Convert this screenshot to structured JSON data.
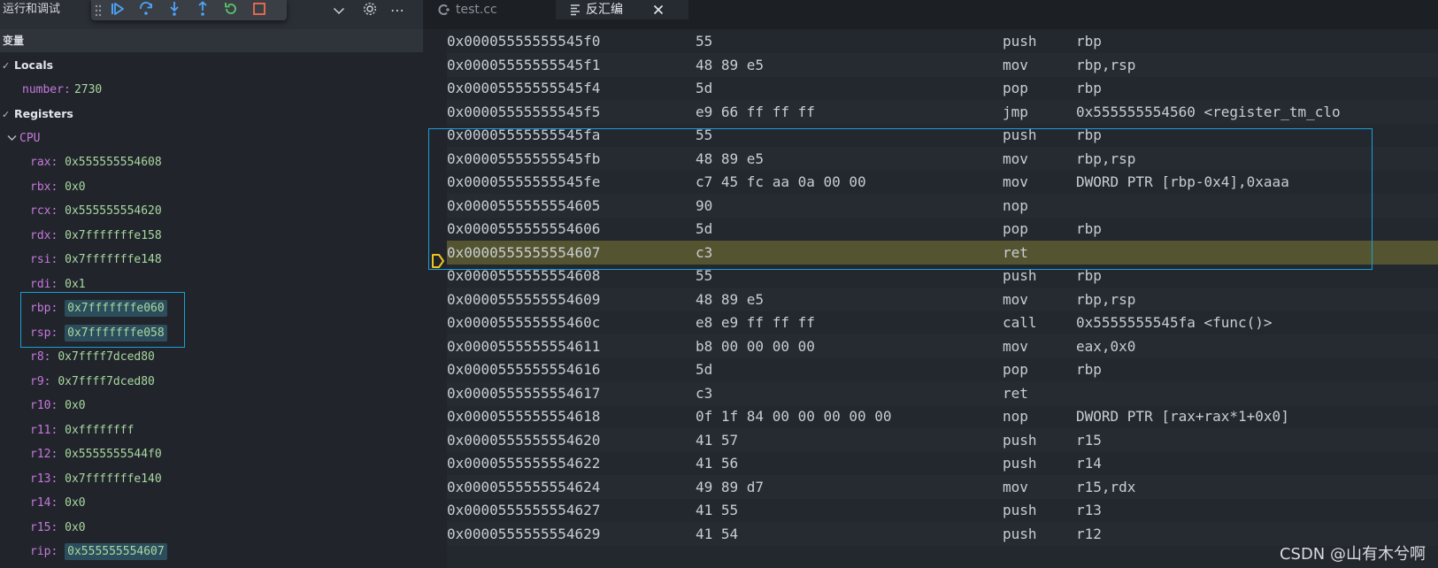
{
  "left_header": {
    "run_title": "运行和调试"
  },
  "debug_toolbar": {
    "buttons": [
      "continue",
      "step-over",
      "step-into",
      "step-out",
      "restart",
      "stop"
    ]
  },
  "variables_panel": {
    "title": "变量",
    "locals": {
      "label": "Locals",
      "vars": [
        {
          "name": "number",
          "value": "2730"
        }
      ]
    },
    "registers": {
      "label": "Registers",
      "cpu_label": "CPU",
      "items": [
        {
          "name": "rax",
          "value": "0x555555554608"
        },
        {
          "name": "rbx",
          "value": "0x0"
        },
        {
          "name": "rcx",
          "value": "0x555555554620"
        },
        {
          "name": "rdx",
          "value": "0x7fffffffe158"
        },
        {
          "name": "rsi",
          "value": "0x7fffffffe148"
        },
        {
          "name": "rdi",
          "value": "0x1"
        },
        {
          "name": "rbp",
          "value": "0x7fffffffe060"
        },
        {
          "name": "rsp",
          "value": "0x7fffffffe058"
        },
        {
          "name": "r8",
          "value": "0x7ffff7dced80"
        },
        {
          "name": "r9",
          "value": "0x7ffff7dced80"
        },
        {
          "name": "r10",
          "value": "0x0"
        },
        {
          "name": "r11",
          "value": "0xffffffff"
        },
        {
          "name": "r12",
          "value": "0x5555555544f0"
        },
        {
          "name": "r13",
          "value": "0x7fffffffe140"
        },
        {
          "name": "r14",
          "value": "0x0"
        },
        {
          "name": "r15",
          "value": "0x0"
        },
        {
          "name": "rip",
          "value": "0x555555554607"
        }
      ],
      "changed": [
        "rbp",
        "rsp",
        "rip"
      ]
    }
  },
  "tabs": [
    {
      "label": "test.cc",
      "active": false
    },
    {
      "label": "反汇编",
      "active": true
    }
  ],
  "disassembly": [
    {
      "addr": "0x00005555555545f0",
      "bytes": "55",
      "mnem": "push",
      "ops": "rbp"
    },
    {
      "addr": "0x00005555555545f1",
      "bytes": "48 89 e5",
      "mnem": "mov",
      "ops": "rbp,rsp"
    },
    {
      "addr": "0x00005555555545f4",
      "bytes": "5d",
      "mnem": "pop",
      "ops": "rbp"
    },
    {
      "addr": "0x00005555555545f5",
      "bytes": "e9 66 ff ff ff",
      "mnem": "jmp",
      "ops": "0x555555554560 <register_tm_clo"
    },
    {
      "addr": "0x00005555555545fa",
      "bytes": "55",
      "mnem": "push",
      "ops": "rbp"
    },
    {
      "addr": "0x00005555555545fb",
      "bytes": "48 89 e5",
      "mnem": "mov",
      "ops": "rbp,rsp"
    },
    {
      "addr": "0x00005555555545fe",
      "bytes": "c7 45 fc aa 0a 00 00",
      "mnem": "mov",
      "ops": "DWORD PTR [rbp-0x4],0xaaa"
    },
    {
      "addr": "0x0000555555554605",
      "bytes": "90",
      "mnem": "nop",
      "ops": ""
    },
    {
      "addr": "0x0000555555554606",
      "bytes": "5d",
      "mnem": "pop",
      "ops": "rbp"
    },
    {
      "addr": "0x0000555555554607",
      "bytes": "c3",
      "mnem": "ret",
      "ops": "",
      "current": true
    },
    {
      "addr": "0x0000555555554608",
      "bytes": "55",
      "mnem": "push",
      "ops": "rbp"
    },
    {
      "addr": "0x0000555555554609",
      "bytes": "48 89 e5",
      "mnem": "mov",
      "ops": "rbp,rsp"
    },
    {
      "addr": "0x000055555555460c",
      "bytes": "e8 e9 ff ff ff",
      "mnem": "call",
      "ops": "0x5555555545fa <func()>"
    },
    {
      "addr": "0x0000555555554611",
      "bytes": "b8 00 00 00 00",
      "mnem": "mov",
      "ops": "eax,0x0"
    },
    {
      "addr": "0x0000555555554616",
      "bytes": "5d",
      "mnem": "pop",
      "ops": "rbp"
    },
    {
      "addr": "0x0000555555554617",
      "bytes": "c3",
      "mnem": "ret",
      "ops": ""
    },
    {
      "addr": "0x0000555555554618",
      "bytes": "0f 1f 84 00 00 00 00 00",
      "mnem": "nop",
      "ops": "DWORD PTR [rax+rax*1+0x0]"
    },
    {
      "addr": "0x0000555555554620",
      "bytes": "41 57",
      "mnem": "push",
      "ops": "r15"
    },
    {
      "addr": "0x0000555555554622",
      "bytes": "41 56",
      "mnem": "push",
      "ops": "r14"
    },
    {
      "addr": "0x0000555555554624",
      "bytes": "49 89 d7",
      "mnem": "mov",
      "ops": "r15,rdx"
    },
    {
      "addr": "0x0000555555554627",
      "bytes": "41 55",
      "mnem": "push",
      "ops": "r13"
    },
    {
      "addr": "0x0000555555554629",
      "bytes": "41 54",
      "mnem": "push",
      "ops": "r12"
    }
  ],
  "watermark": "CSDN @山有木兮啊",
  "colors": {
    "accent_box": "#1a9fd8",
    "current_line": "#545430",
    "register_name": "#c678dd",
    "register_value": "#a9d7a0",
    "arrow": "#f0c419"
  }
}
